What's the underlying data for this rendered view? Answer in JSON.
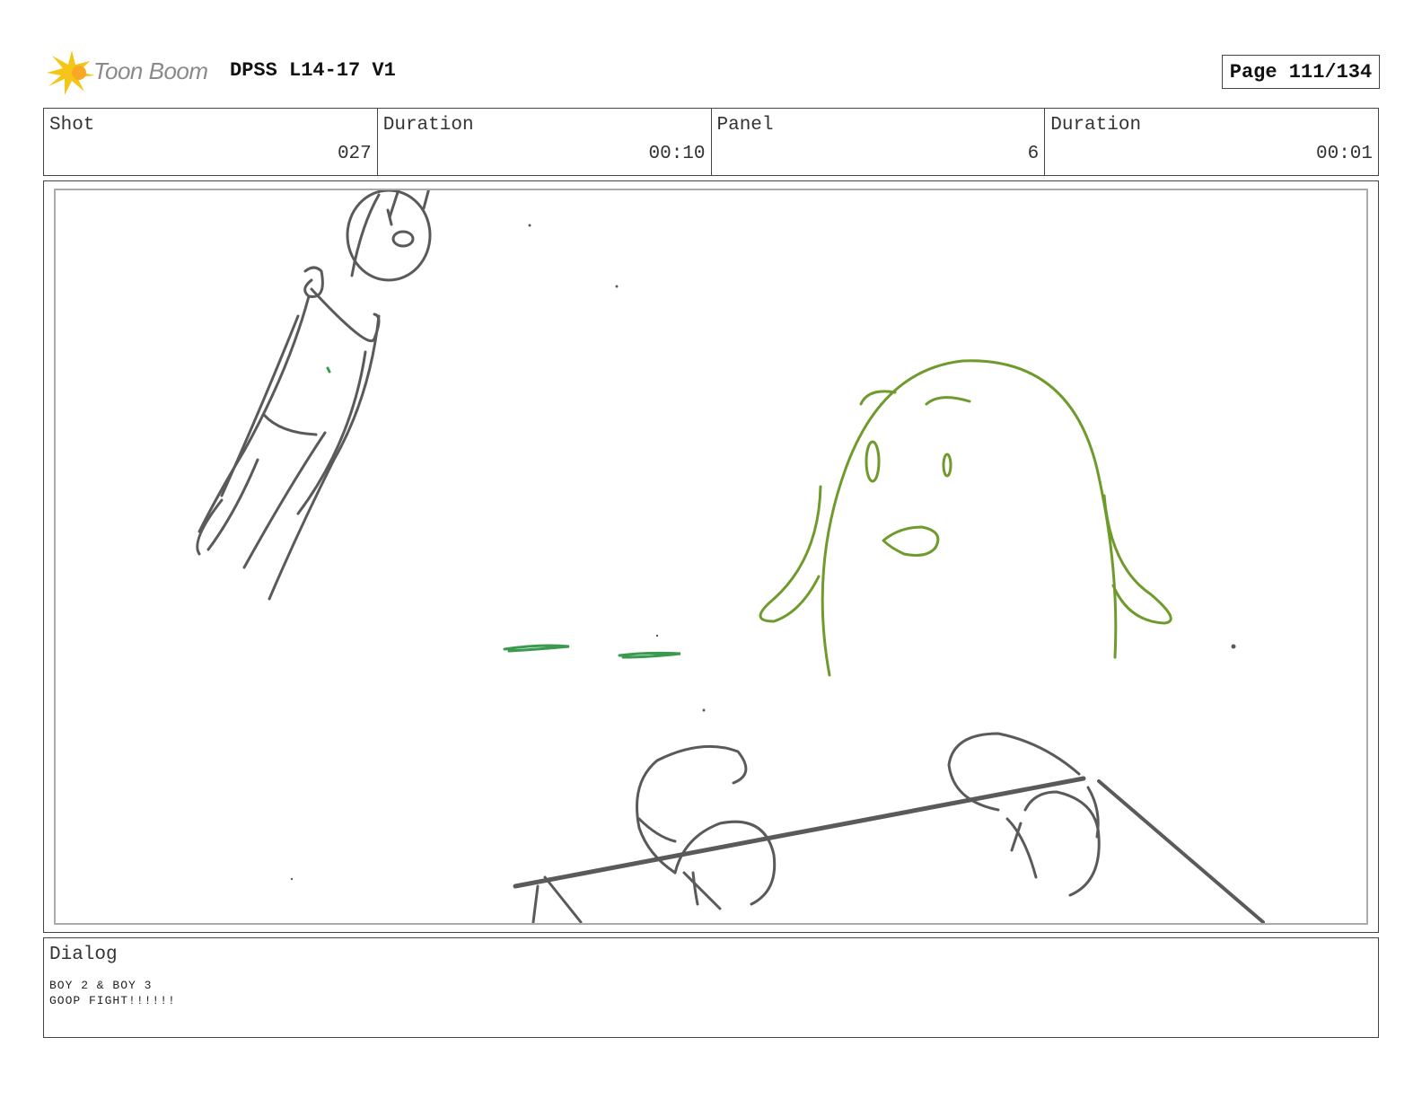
{
  "header": {
    "logo_text": "Toon Boom",
    "doc_title": "DPSS L14-17 V1",
    "page_label": "Page 111/134"
  },
  "info": {
    "shot_label": "Shot",
    "shot_value": "027",
    "shot_duration_label": "Duration",
    "shot_duration_value": "00:10",
    "panel_label": "Panel",
    "panel_value": "6",
    "panel_duration_label": "Duration",
    "panel_duration_value": "00:01"
  },
  "dialog": {
    "label": "Dialog",
    "line1": "BOY 2 & BOY 3",
    "line2": "GOOP FIGHT!!!!!!"
  },
  "colors": {
    "sketch_gray": "#5a5a5a",
    "sketch_green": "#6f9a2c",
    "goop_green": "#3c9a50",
    "logo_yellow": "#f5c518"
  }
}
